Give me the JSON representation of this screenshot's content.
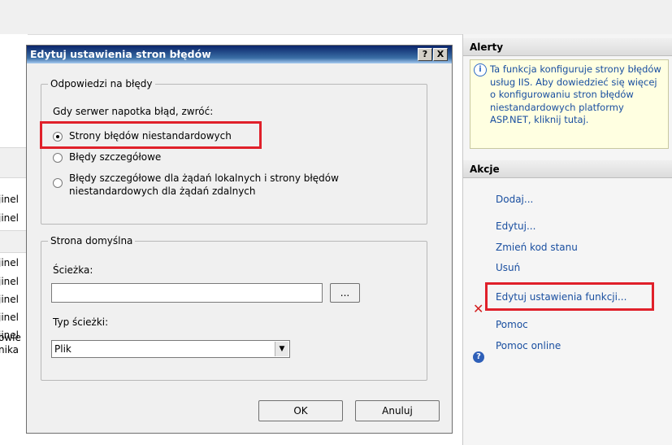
{
  "background": {
    "left_fragments": [
      "owie",
      "nika",
      "jinel",
      "jinel",
      "jinel",
      "jinel",
      "jinel",
      "jinel",
      "jinel"
    ]
  },
  "dialog": {
    "title": "Edytuj ustawienia stron błędów",
    "help_button": "?",
    "close_button": "X",
    "responses_group": {
      "legend": "Odpowiedzi na błędy",
      "prompt": "Gdy serwer napotka błąd, zwróć:",
      "options": [
        {
          "label": "Strony błędów niestandardowych",
          "selected": true
        },
        {
          "label": "Błędy szczegółowe",
          "selected": false
        },
        {
          "label": "Błędy szczegółowe dla żądań lokalnych i strony błędów",
          "label_line2": "niestandardowych dla żądań zdalnych",
          "selected": false
        }
      ]
    },
    "default_page_group": {
      "legend": "Strona domyślna",
      "path_label": "Ścieżka:",
      "path_value": "",
      "browse_button": "...",
      "path_type_label": "Typ ścieżki:",
      "path_type_value": "Plik"
    },
    "ok_button": "OK",
    "cancel_button": "Anuluj"
  },
  "actions_pane": {
    "alerts_header": "Alerty",
    "alert_text": "Ta funkcja konfiguruje strony błędów usług IIS. Aby dowiedzieć się więcej o konfigurowaniu stron błędów niestandardowych platformy ASP.NET, kliknij tutaj.",
    "actions_header": "Akcje",
    "items": [
      "Dodaj...",
      "Edytuj...",
      "Zmień kod stanu",
      "Usuń",
      "Edytuj ustawienia funkcji...",
      "Pomoc",
      "Pomoc online"
    ]
  },
  "colors": {
    "highlight": "#e0202a",
    "link": "#1a4fa0",
    "titlebar": "#0a246a"
  }
}
